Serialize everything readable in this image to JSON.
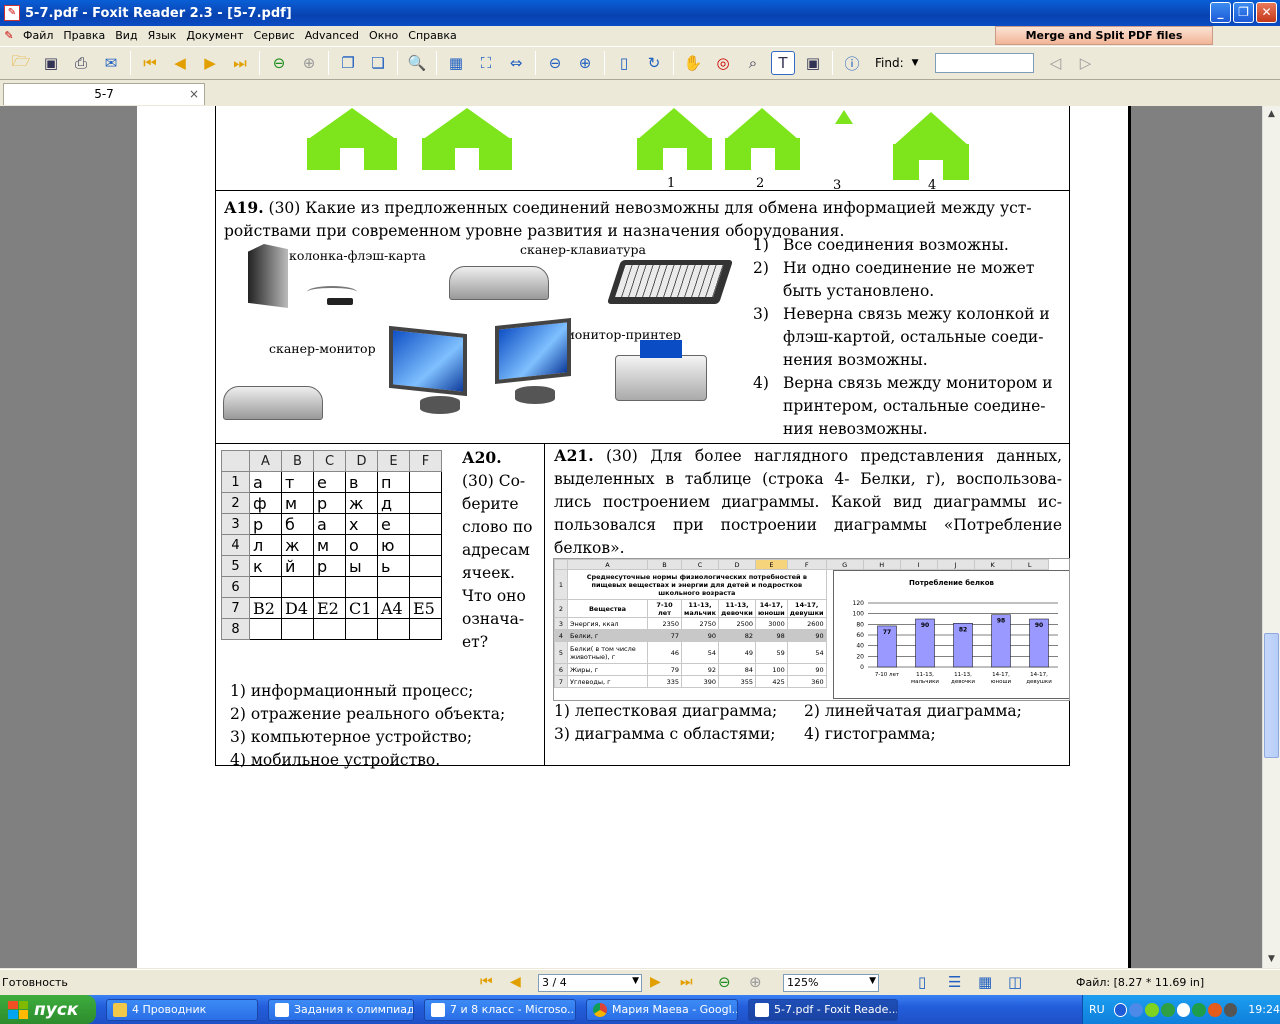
{
  "window": {
    "title": "5-7.pdf - Foxit Reader 2.3 - [5-7.pdf]",
    "buttons": [
      "_",
      "❐",
      "✕"
    ]
  },
  "menu": [
    "Файл",
    "Правка",
    "Вид",
    "Язык",
    "Документ",
    "Сервис",
    "Advanced",
    "Окно",
    "Справка"
  ],
  "merge_button": "Merge and Split PDF files",
  "toolbar": {
    "find_label": "Find:",
    "find_value": ""
  },
  "tab": {
    "label": "5-7",
    "close": "×"
  },
  "page": {
    "house_labels": [
      "1",
      "2",
      "3",
      "4"
    ],
    "a19": {
      "num": "А19.",
      "text_line1": " (30) Какие из предложенных соединений невозможны для обмена информацией между уст-",
      "text_line2": "ройствами при современном уровне развития и назначения оборудования.",
      "captions": [
        "колонка-флэш-карта",
        "сканер-клавиатура",
        "сканер-монитор",
        "монитор-принтер"
      ],
      "options": [
        {
          "n": "1)",
          "lines": [
            "Все соединения возможны."
          ]
        },
        {
          "n": "2)",
          "lines": [
            " Ни одно соединение не может",
            "быть установлено."
          ]
        },
        {
          "n": "3)",
          "lines": [
            "Неверна связь межу колонкой и",
            "флэш-картой, остальные соеди-",
            "нения возможны."
          ]
        },
        {
          "n": "4)",
          "lines": [
            "Верна связь между монитором и",
            "принтером, остальные соедине-",
            "ния невозможны."
          ]
        }
      ]
    },
    "a20": {
      "cols": [
        "",
        "A",
        "B",
        "C",
        "D",
        "E",
        "F"
      ],
      "rows": [
        [
          "1",
          "а",
          "т",
          "е",
          "в",
          "п",
          ""
        ],
        [
          "2",
          "ф",
          "м",
          "р",
          "ж",
          "д",
          ""
        ],
        [
          "3",
          "р",
          "б",
          "а",
          "х",
          "е",
          ""
        ],
        [
          "4",
          "л",
          "ж",
          "м",
          "о",
          "ю",
          ""
        ],
        [
          "5",
          "к",
          "й",
          "р",
          "ы",
          "ь",
          ""
        ],
        [
          "6",
          "",
          "",
          "",
          "",
          "",
          ""
        ],
        [
          "7",
          "В2",
          "D4",
          "E2",
          "C1",
          "A4",
          "E5"
        ],
        [
          "8",
          "",
          "",
          "",
          "",
          "",
          ""
        ]
      ],
      "num": "А20.",
      "side_lines": [
        "(30) Со-",
        "берите",
        "слово по",
        "адресам",
        "ячеек.",
        "Что оно",
        "означа-",
        "ет?"
      ],
      "options": [
        "1) информационный процесс;",
        "2) отражение реального объекта;",
        "3) компьютерное устройство;",
        "4) мобильное устройство."
      ]
    },
    "a21": {
      "num": "А21.",
      "lines": [
        " (30) Для более наглядного представления данных,",
        "выделенных в таблице (строка 4- Белки, г), воспользова-",
        "лись построением диаграммы. Какой вид диаграммы ис-",
        "пользовался при построении диаграммы «Потребление",
        "белков»."
      ],
      "options": [
        "1) лепестковая диаграмма;",
        "2) линейчатая диаграмма;",
        "3) диаграмма с областями;",
        "4) гистограмма;"
      ],
      "sheet": {
        "col_letters": [
          "",
          "A",
          "B",
          "C",
          "D",
          "E",
          "F",
          "G",
          "H",
          "I",
          "J",
          "K",
          "L"
        ],
        "title_lines": [
          "Среднесуточные нормы физиологических потребностей в",
          "пищевых веществах и энергии для детей и подростков",
          "школьного возраста"
        ],
        "header": [
          "Вещества",
          "7-10 лет",
          "11-13, мальчик",
          "11-13, девочки",
          "14-17, юноши",
          "14-17, девушки"
        ],
        "rows": [
          {
            "n": "3",
            "name": "Энергия, ккал",
            "vals": [
              "2350",
              "2750",
              "2500",
              "3000",
              "2600"
            ]
          },
          {
            "n": "4",
            "name": "Белки, г",
            "vals": [
              "77",
              "90",
              "82",
              "98",
              "90"
            ]
          },
          {
            "n": "5",
            "name": "Белки( в том числе животные), г",
            "vals": [
              "46",
              "54",
              "49",
              "59",
              "54"
            ]
          },
          {
            "n": "6",
            "name": "Жиры, г",
            "vals": [
              "79",
              "92",
              "84",
              "100",
              "90"
            ]
          },
          {
            "n": "7",
            "name": "Углеводы, г",
            "vals": [
              "335",
              "390",
              "355",
              "425",
              "360"
            ]
          }
        ]
      }
    }
  },
  "chart_data": {
    "type": "bar",
    "title": "Потребление белков",
    "categories": [
      "7-10 лет",
      "11-13, мальчики",
      "11-13, девочки",
      "14-17, юноши",
      "14-17, девушки"
    ],
    "values": [
      77,
      90,
      82,
      98,
      90
    ],
    "ylim": [
      0,
      120
    ],
    "yticks": [
      "0",
      "20",
      "40",
      "60",
      "80",
      "100",
      "120"
    ],
    "bar_color": "#9999ff",
    "grid": true
  },
  "statusbar": {
    "status": "Готовность",
    "page": "3 / 4",
    "zoom": "125%",
    "file_info": "Файл: [8.27 * 11.69 in]"
  },
  "taskbar": {
    "start": "пуск",
    "tasks": [
      "4 Проводник",
      "Задания к олимпиад...",
      "7 и 8  класс - Microso...",
      "Мария Маева - Googl...",
      "5-7.pdf - Foxit Reade..."
    ],
    "lang": "RU",
    "clock": "19:24"
  }
}
